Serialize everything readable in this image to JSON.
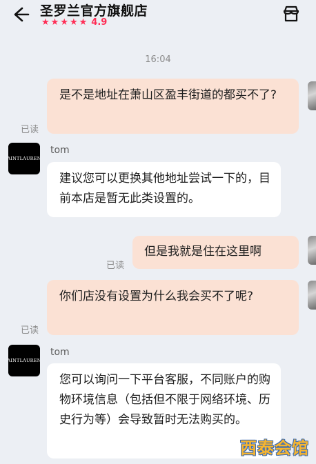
{
  "header": {
    "title": "圣罗兰官方旗舰店",
    "stars": [
      "★",
      "★",
      "★",
      "★",
      "★"
    ],
    "rating": "4.9",
    "back_icon": "arrow-left-icon",
    "store_icon": "store-icon"
  },
  "timestamp": "16:04",
  "messages": [
    {
      "from": "me",
      "text": "是不是地址在萧山区盈丰街道的都买不了?",
      "status": "已读"
    },
    {
      "from": "shop",
      "sender": "tom",
      "avatar_text": "SAINTLAURENT",
      "text": "建议您可以更换其他地址尝试一下的，目前本店是暂无此类设置的。"
    },
    {
      "from": "me",
      "text": "但是我就是住在这里啊",
      "status": "已读"
    },
    {
      "from": "me",
      "text": "你们店没有设置为什么我会买不了呢?",
      "status": "已读"
    },
    {
      "from": "shop",
      "sender": "tom",
      "avatar_text": "SAINTLAURENT",
      "text": "您可以询问一下平台客服，不同账户的购物环境信息（包括但不限于网络环境、历史行为等）会导致暂时无法购买的。"
    }
  ],
  "watermark": "西泰会馆",
  "colors": {
    "accent": "#ff2d55",
    "out_bubble": "#fbe1d4",
    "in_bubble": "#ffffff",
    "background": "#eceff4"
  }
}
